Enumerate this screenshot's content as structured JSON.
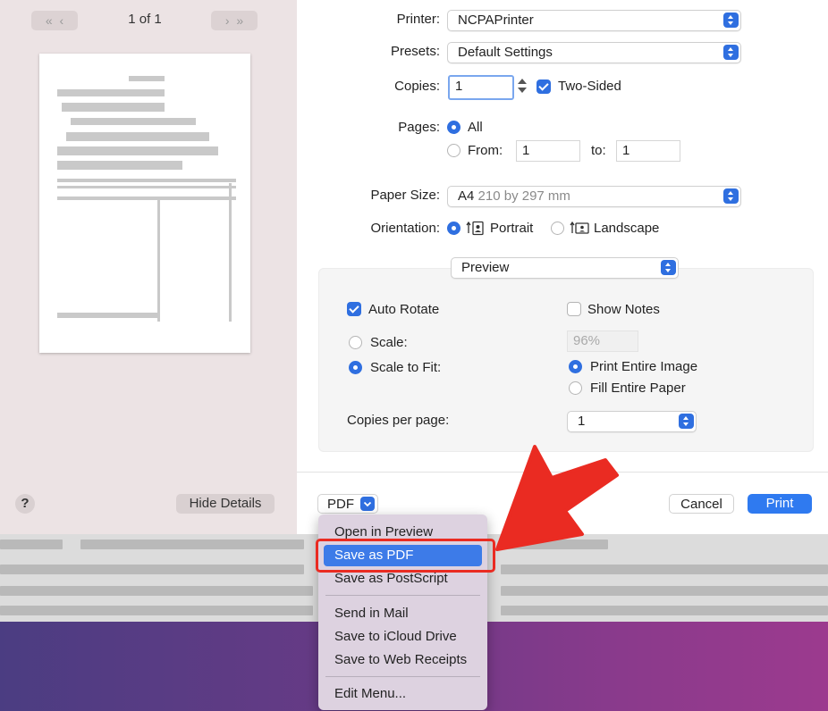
{
  "preview": {
    "page_indicator": "1 of 1",
    "first_icon": "«",
    "prev_icon": "‹",
    "next_icon": "›",
    "last_icon": "»"
  },
  "printer": {
    "label": "Printer:",
    "value": "NCPAPrinter"
  },
  "presets": {
    "label": "Presets:",
    "value": "Default Settings"
  },
  "copies": {
    "label": "Copies:",
    "value": "1",
    "two_sided_label": "Two-Sided",
    "two_sided_checked": true
  },
  "pages": {
    "label": "Pages:",
    "all_label": "All",
    "from_label": "From:",
    "from_value": "1",
    "to_label": "to:",
    "to_value": "1"
  },
  "paper_size": {
    "label": "Paper Size:",
    "value": "A4",
    "detail": "210 by 297 mm"
  },
  "orientation": {
    "label": "Orientation:",
    "portrait_label": "Portrait",
    "landscape_label": "Landscape",
    "selected": "portrait"
  },
  "section": {
    "popup_value": "Preview",
    "auto_rotate_label": "Auto Rotate",
    "show_notes_label": "Show Notes",
    "scale_label": "Scale:",
    "scale_value": "96%",
    "scale_to_fit_label": "Scale to Fit:",
    "print_entire_image_label": "Print Entire Image",
    "fill_entire_paper_label": "Fill Entire Paper",
    "copies_per_page_label": "Copies per page:",
    "copies_per_page_value": "1"
  },
  "footer": {
    "help_label": "?",
    "hide_details_label": "Hide Details",
    "pdf_label": "PDF",
    "cancel_label": "Cancel",
    "print_label": "Print"
  },
  "pdf_menu": {
    "items": [
      "Open in Preview",
      "Save as PDF",
      "Save as PostScript",
      "Send in Mail",
      "Save to iCloud Drive",
      "Save to Web Receipts",
      "Edit Menu..."
    ],
    "selected": "Save as PDF"
  },
  "colors": {
    "accent": "#2f6fe0",
    "annotation": "#ea2b22",
    "sidebar": "#ece3e4"
  }
}
